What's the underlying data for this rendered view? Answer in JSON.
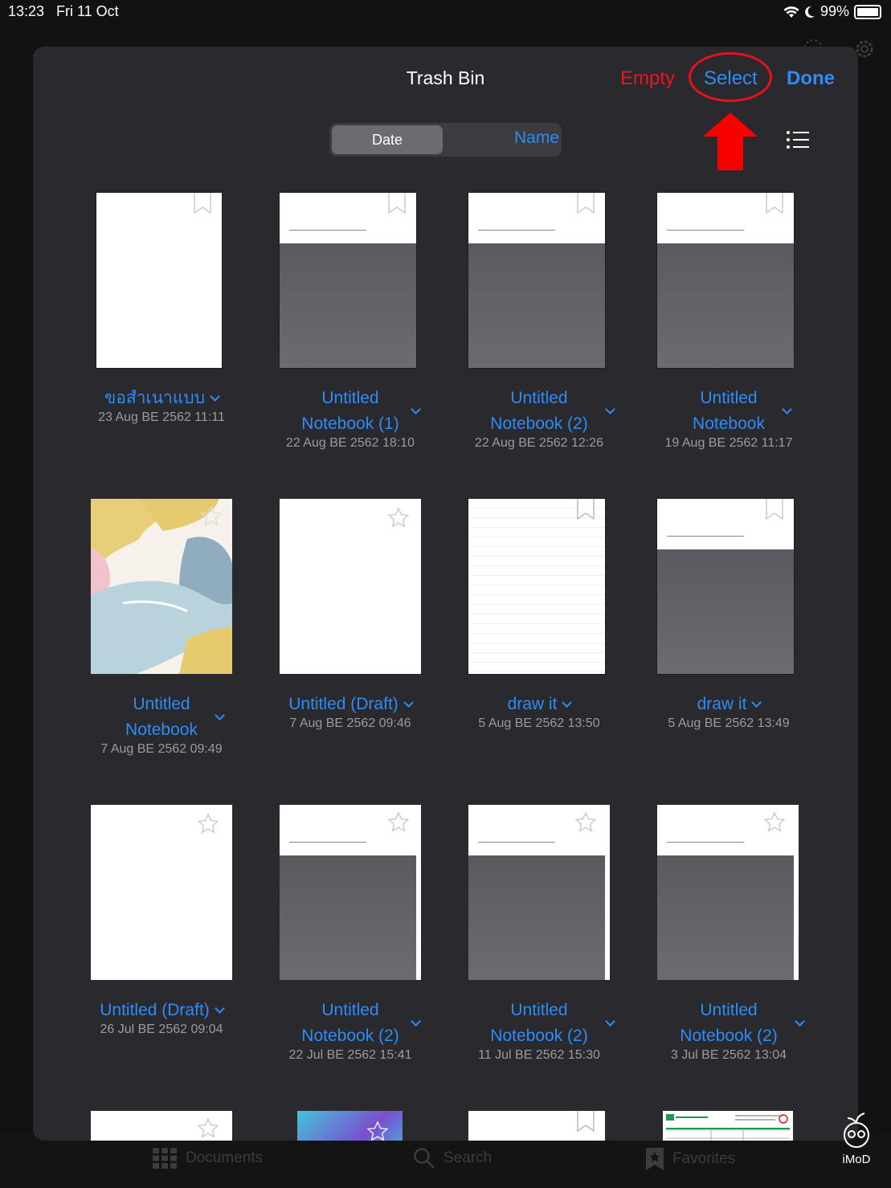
{
  "status": {
    "time": "13:23",
    "date": "Fri 11 Oct",
    "battery": "99%"
  },
  "sheet": {
    "title": "Trash Bin",
    "empty_label": "Empty",
    "select_label": "Select",
    "done_label": "Done",
    "sort": {
      "options": [
        "Date",
        "Name"
      ],
      "selected": "Date"
    }
  },
  "items": [
    {
      "name": "ขอสำเนาแบบ",
      "date": "23 Aug BE 2562 11:11",
      "thumb": "white",
      "marker": "bookmark"
    },
    {
      "name_lines": [
        "Untitled",
        "Notebook (1)"
      ],
      "date": "22 Aug BE 2562 18:10",
      "thumb": "grey",
      "marker": "bookmark"
    },
    {
      "name_lines": [
        "Untitled",
        "Notebook (2)"
      ],
      "date": "22 Aug BE 2562 12:26",
      "thumb": "grey",
      "marker": "bookmark"
    },
    {
      "name_lines": [
        "Untitled",
        "Notebook"
      ],
      "date": "19 Aug BE 2562 11:17",
      "thumb": "grey",
      "marker": "bookmark"
    },
    {
      "name_lines": [
        "Untitled",
        "Notebook"
      ],
      "date": "7 Aug BE 2562 09:49",
      "thumb": "cover",
      "marker": "star"
    },
    {
      "name": "Untitled (Draft)",
      "date": "7 Aug BE 2562 09:46",
      "thumb": "white",
      "marker": "star"
    },
    {
      "name": "draw it",
      "date": "5 Aug BE 2562 13:50",
      "thumb": "lined",
      "marker": "bookmark"
    },
    {
      "name": "draw it",
      "date": "5 Aug BE 2562 13:49",
      "thumb": "grey",
      "marker": "bookmark"
    },
    {
      "name": "Untitled (Draft)",
      "date": "26 Jul BE 2562 09:04",
      "thumb": "white",
      "marker": "star"
    },
    {
      "name_lines": [
        "Untitled",
        "Notebook (2)"
      ],
      "date": "22 Jul BE 2562 15:41",
      "thumb": "grey",
      "marker": "star"
    },
    {
      "name_lines": [
        "Untitled",
        "Notebook (2)"
      ],
      "date": "11 Jul BE 2562 15:30",
      "thumb": "grey",
      "marker": "star"
    },
    {
      "name_lines": [
        "Untitled",
        "Notebook (2)"
      ],
      "date": "3 Jul BE 2562 13:04",
      "thumb": "grey",
      "marker": "star"
    }
  ],
  "tabbar": {
    "documents": "Documents",
    "search": "Search",
    "favorites": "Favorites"
  },
  "watermark": "iMoD",
  "colors": {
    "accent": "#2e8cf5",
    "destructive": "#e3181f",
    "sheet_bg": "#2a2a2e",
    "annotation": "#e3121b"
  }
}
